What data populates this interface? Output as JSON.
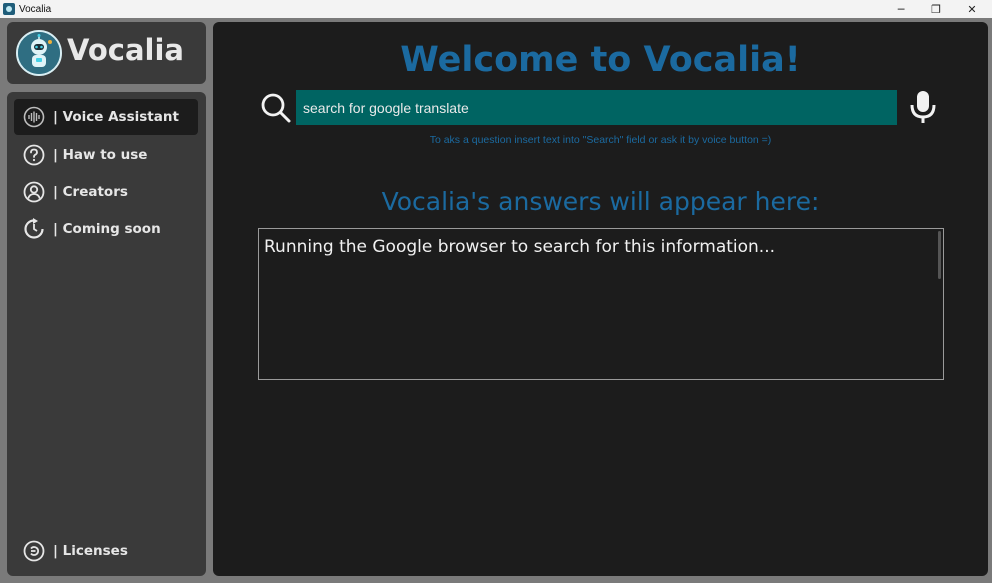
{
  "window": {
    "title": "Vocalia",
    "minimize_glyph": "─",
    "restore_glyph": "❐",
    "close_glyph": "✕"
  },
  "logo": {
    "name": "Vocalia",
    "icon": "robot-avatar"
  },
  "sidebar": {
    "items": [
      {
        "label": "| Voice Assistant",
        "icon": "voice-wave-icon",
        "active": true
      },
      {
        "label": "| Haw to use",
        "icon": "help-circle-icon",
        "active": false
      },
      {
        "label": "| Creators",
        "icon": "user-circle-icon",
        "active": false
      },
      {
        "label": "| Coming soon",
        "icon": "refresh-icon",
        "active": false
      }
    ],
    "footer": {
      "label": "| Licenses",
      "icon": "license-icon"
    }
  },
  "main": {
    "welcome": "Welcome to Vocalia!",
    "search": {
      "value": "search for google translate",
      "icon": "search-icon"
    },
    "mic_icon": "microphone-icon",
    "hint": "To aks a question insert text into \"Search\" field or ask it by voice button =)",
    "answers_title": "Vocalia's answers will appear here:",
    "answer_text": "Running the Google browser to search for this information..."
  },
  "colors": {
    "accent": "#1b6aa0",
    "search_bg": "#006462",
    "panel": "#3a3a3a",
    "main_bg": "#1c1c1c"
  }
}
